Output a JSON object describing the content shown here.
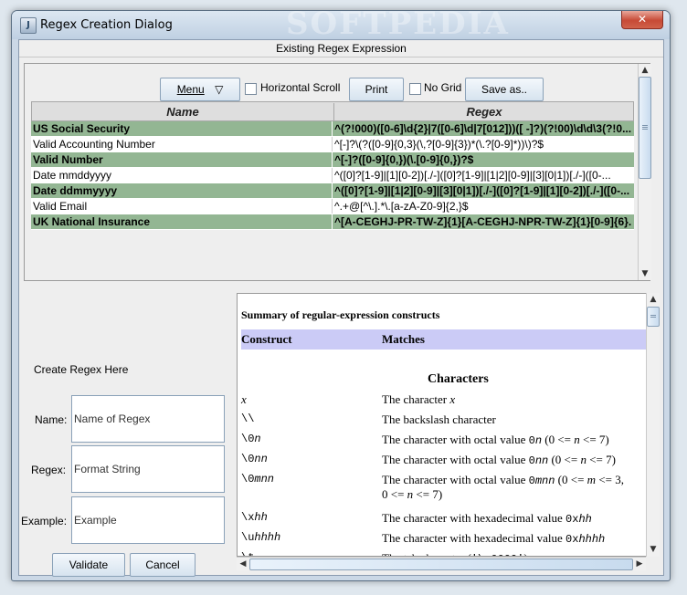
{
  "window": {
    "title": "Regex Creation Dialog",
    "watermark": "SOFTPEDIA",
    "close": "✕"
  },
  "header": "Existing Regex Expression",
  "toolbar": {
    "menu_label": "Menu",
    "menu_arrow": "▽",
    "hscroll_label": "Horizontal Scroll",
    "print_label": "Print",
    "nogrid_label": "No Grid",
    "saveas_label": "Save as.."
  },
  "table": {
    "columns": [
      "Name",
      "Regex"
    ],
    "rows": [
      {
        "name": "US Social Security",
        "regex": "^(?!000)([0-6]\\d{2}|7([0-6]\\d|7[012]))([ -]?)(?!00)\\d\\d\\3(?!0..."
      },
      {
        "name": "Valid Accounting Number",
        "regex": "^[-]?\\(?([0-9]{0,3}(\\,?[0-9]{3})*(\\.?[0-9]*))\\)?$"
      },
      {
        "name": "Valid Number",
        "regex": "^[-]?([0-9]{0,})(\\.[0-9]{0,})?$"
      },
      {
        "name": "Date mmddyyyy",
        "regex": "^([0]?[1-9]|[1][0-2])[./-]([0]?[1-9]|[1|2][0-9]|[3][0|1])[./-]([0-..."
      },
      {
        "name": "Date ddmmyyyy",
        "regex": "^([0]?[1-9]|[1|2][0-9]|[3][0|1])[./-]([0]?[1-9]|[1][0-2])[./-]([0-..."
      },
      {
        "name": "Valid Email",
        "regex": "^.+@[^\\.].*\\.[a-zA-Z0-9]{2,}$"
      },
      {
        "name": "UK National Insurance",
        "regex": "^[A-CEGHJ-PR-TW-Z]{1}[A-CEGHJ-NPR-TW-Z]{1}[0-9]{6}..."
      }
    ]
  },
  "form": {
    "heading": "Create Regex Here",
    "name_label": "Name:",
    "name_value": "Name of Regex",
    "regex_label": "Regex:",
    "regex_value": "Format String",
    "example_label": "Example:",
    "example_value": "Example",
    "validate_label": "Validate",
    "cancel_label": "Cancel"
  },
  "doc": {
    "title": "Summary of regular-expression constructs",
    "col_construct": "Construct",
    "col_matches": "Matches",
    "section": "Characters"
  }
}
